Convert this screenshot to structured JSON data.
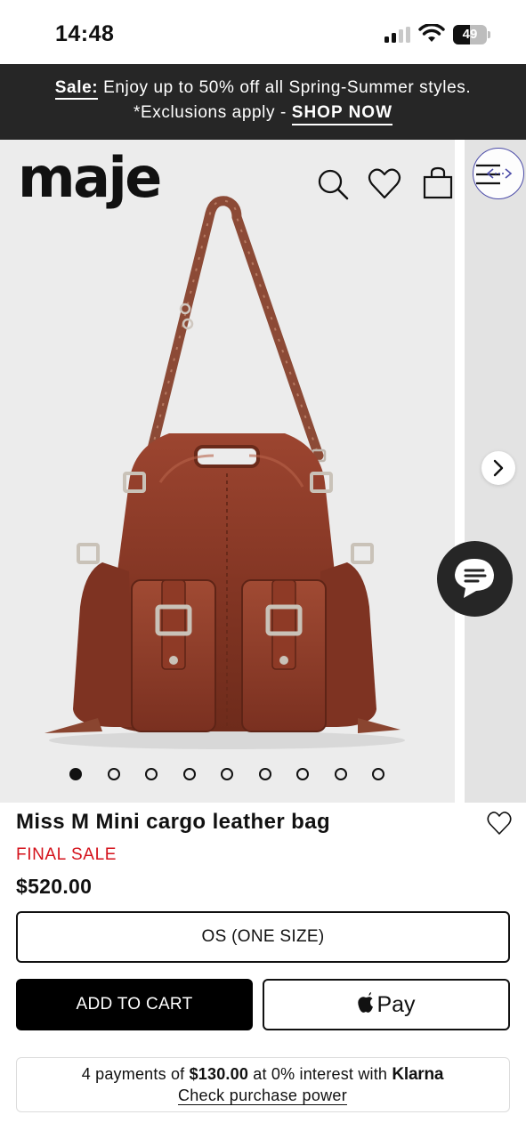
{
  "status_bar": {
    "time": "14:48",
    "battery_level": "49",
    "battery_fraction": 0.49,
    "signal_bars_active": 2,
    "icons": [
      "signal-icon",
      "wifi-icon",
      "battery-icon"
    ]
  },
  "promo": {
    "sale_label": "Sale:",
    "sale_text": " Enjoy up to 50% off all Spring-Summer styles.",
    "exclusions": "*Exclusions apply - ",
    "cta": "SHOP NOW"
  },
  "header": {
    "logo": "maje",
    "icons": [
      "search-icon",
      "heart-icon",
      "bag-icon",
      "menu-icon"
    ]
  },
  "gallery": {
    "image_count": 9,
    "active_index": 0,
    "next_icon": "chevron-right-icon",
    "chat_icon": "chat-icon"
  },
  "product": {
    "title": "Miss M Mini cargo leather bag",
    "sale_tag": "FINAL SALE",
    "price": "$520.00",
    "size": "OS (ONE SIZE)",
    "add_to_cart": "ADD TO CART",
    "apple_pay": "Pay"
  },
  "klarna": {
    "prefix": "4 payments of ",
    "amount": "$130.00",
    "middle": " at 0% interest with ",
    "brand": "Klarna",
    "link": "Check purchase power"
  },
  "colors": {
    "banner_bg": "#262626",
    "sale_red": "#d4121b",
    "bag_brown": "#8a3a24",
    "gallery_bg": "#ececec"
  }
}
